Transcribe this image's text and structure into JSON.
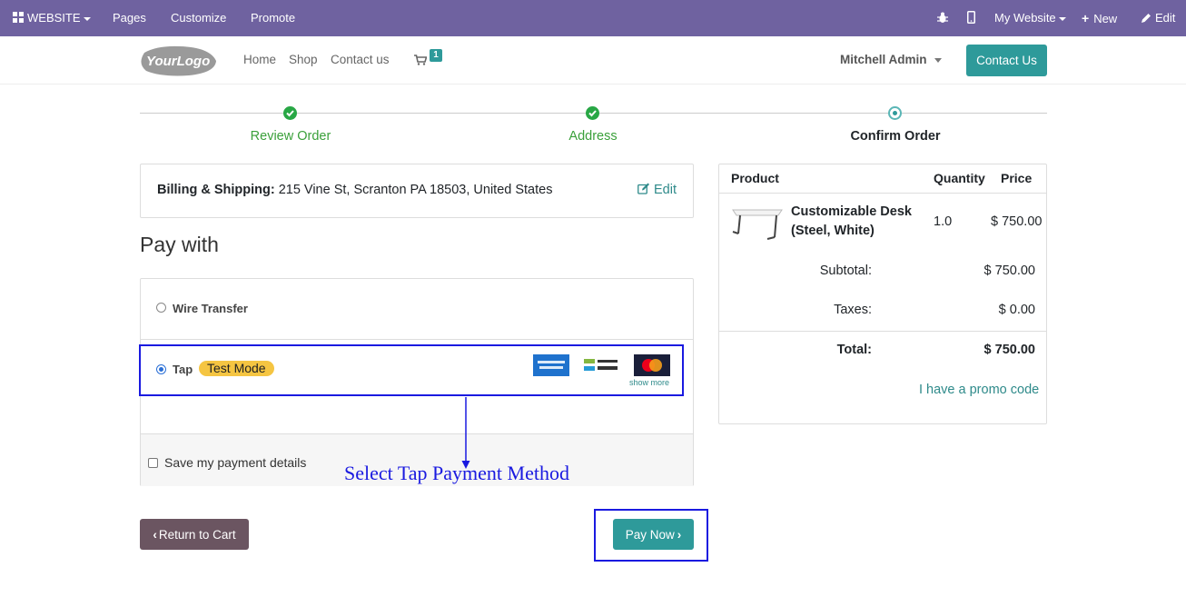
{
  "admin_bar": {
    "website_label": "WEBSITE",
    "pages_label": "Pages",
    "customize_label": "Customize",
    "promote_label": "Promote",
    "my_website_label": "My Website",
    "new_label": "New",
    "edit_label": "Edit"
  },
  "header": {
    "logo_text": "YourLogo",
    "nav": [
      "Home",
      "Shop",
      "Contact us"
    ],
    "cart_count": "1",
    "user_name": "Mitchell Admin",
    "contact_button": "Contact Us"
  },
  "steps": [
    {
      "label": "Review Order",
      "status": "done"
    },
    {
      "label": "Address",
      "status": "done"
    },
    {
      "label": "Confirm Order",
      "status": "current"
    }
  ],
  "address": {
    "label": "Billing & Shipping:",
    "value": "215 Vine St, Scranton PA 18503, United States",
    "edit_label": "Edit"
  },
  "payment": {
    "heading": "Pay with",
    "methods": [
      {
        "name": "Wire Transfer",
        "selected": false
      },
      {
        "name": "Tap",
        "selected": true,
        "badge": "Test Mode",
        "icons": [
          "amex-icon",
          "mada-icon",
          "mastercard-icon"
        ],
        "show_more": "show more"
      }
    ],
    "save_details_label": "Save my payment details",
    "save_details_checked": false
  },
  "annotation": {
    "text": "Select Tap Payment Method",
    "color": "#1a1ae0"
  },
  "actions": {
    "return_label": "Return to Cart",
    "pay_now_label": "Pay Now"
  },
  "summary": {
    "columns": [
      "Product",
      "Quantity",
      "Price"
    ],
    "items": [
      {
        "name_line1": "Customizable Desk",
        "name_line2": "(Steel, White)",
        "quantity": "1.0",
        "price": "$ 750.00"
      }
    ],
    "subtotal_label": "Subtotal:",
    "subtotal": "$ 750.00",
    "taxes_label": "Taxes:",
    "taxes": "$ 0.00",
    "total_label": "Total:",
    "total": "$ 750.00",
    "promo_label": "I have a promo code"
  },
  "colors": {
    "admin_bar": "#6f62a0",
    "primary": "#2e9a9a",
    "success": "#28a745",
    "return_button": "#6b5561",
    "badge": "#f5c542"
  }
}
